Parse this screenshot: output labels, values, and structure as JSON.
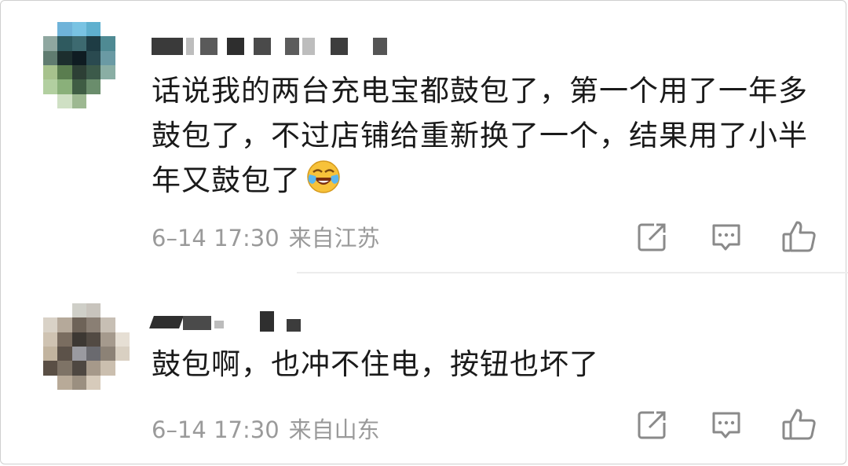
{
  "comments": [
    {
      "text": "话说我的两台充电宝都鼓包了，第一个用了一年多鼓包了，不过店铺给重新换了一个，结果用了小半年又鼓包了",
      "emoji": "laugh-cry-emoji",
      "time": "6–14 17:30",
      "location": "来自江苏"
    },
    {
      "text": "鼓包啊，也冲不住电，按钮也坏了",
      "time": "6–14 17:30",
      "location": "来自山东"
    }
  ],
  "icons": {
    "share": "share-icon",
    "reply": "reply-icon",
    "like": "like-icon"
  },
  "colors": {
    "text": "#1a1a1a",
    "meta": "#9a9a9a",
    "icon": "#8a8a8a",
    "divider": "#ececec"
  }
}
